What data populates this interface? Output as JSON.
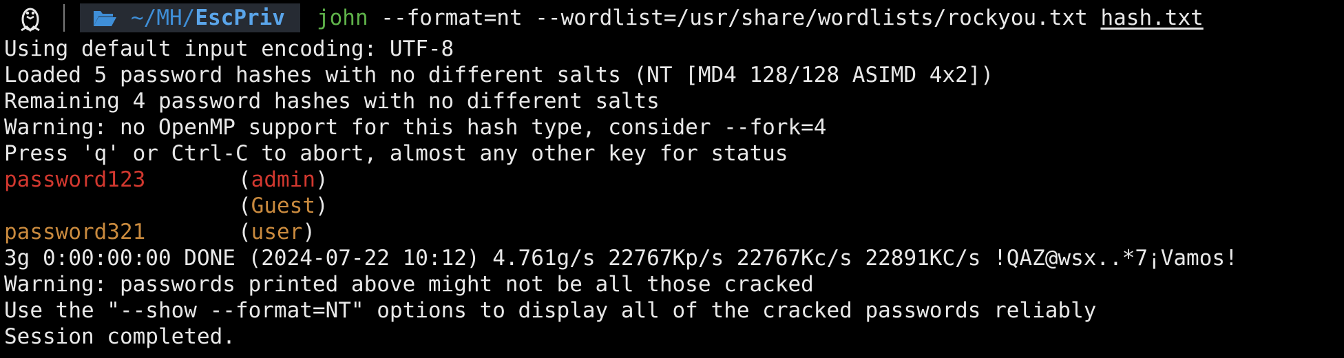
{
  "prompt": {
    "icons": {
      "os": "linux-tux-icon",
      "folder": "folder-open-icon"
    },
    "dir_prefix": "~/MH/",
    "dir_current": "EscPriv",
    "command_name": "john",
    "command_args": " --format=nt --wordlist=/usr/share/wordlists/rockyou.txt ",
    "command_file": "hash.txt",
    "colors": {
      "command_name": "#5fb34a",
      "dir_path": "#3f8fd8",
      "dir_background": "#262b33"
    }
  },
  "output": {
    "lines_before": [
      "Using default input encoding: UTF-8",
      "Loaded 5 password hashes with no different salts (NT [MD4 128/128 ASIMD 4x2])",
      "Remaining 4 password hashes with no different salts",
      "Warning: no OpenMP support for this hash type, consider --fork=4",
      "Press 'q' or Ctrl-C to abort, almost any other key for status"
    ],
    "cracked": [
      {
        "password": "password123",
        "user": "admin",
        "color": "#d2382f"
      },
      {
        "password": "",
        "user": "Guest",
        "color": "#c98a3e"
      },
      {
        "password": "password321",
        "user": "user",
        "color": "#c98a3e"
      }
    ],
    "lines_after": [
      "3g 0:00:00:00 DONE (2024-07-22 10:12) 4.761g/s 22767Kp/s 22767Kc/s 22891KC/s !QAZ@wsx..*7¡Vamos!",
      "Warning: passwords printed above might not be all those cracked",
      "Use the \"--show --format=NT\" options to display all of the cracked passwords reliably",
      "Session completed."
    ]
  }
}
